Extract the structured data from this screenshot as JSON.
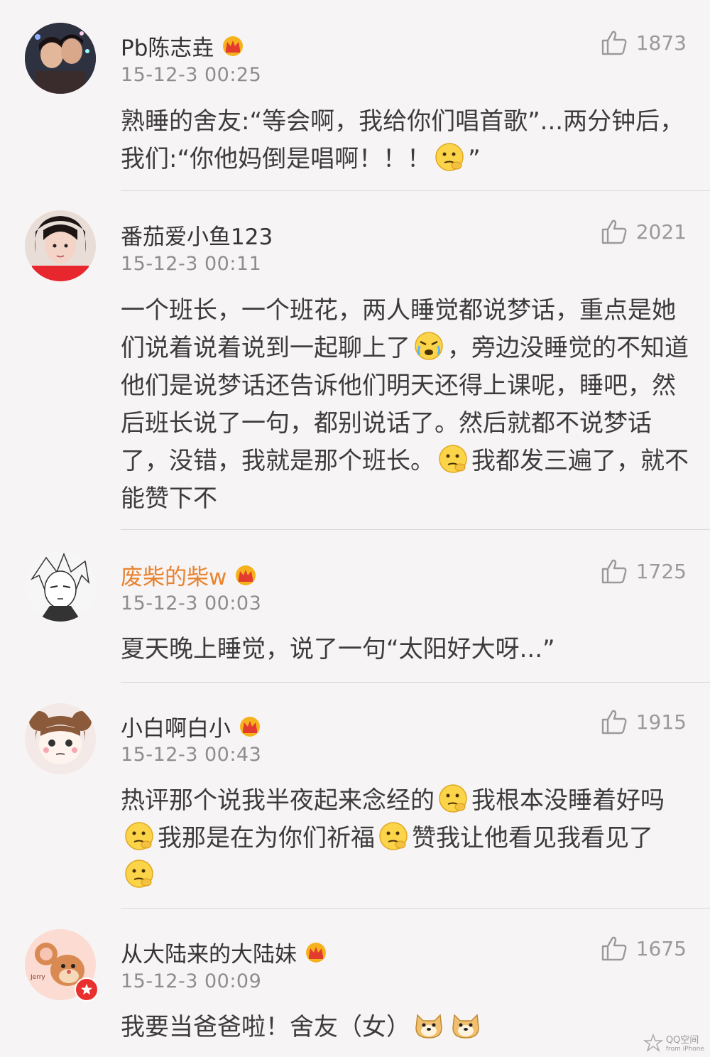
{
  "comments": [
    {
      "name": "Pb陈志垚",
      "time": "15-12-3 00:25",
      "likes": "1873",
      "vip": true,
      "avatar": "avatar-couple",
      "parts": [
        "熟睡的舍友:“等会啊，我给你们唱首歌”...两分钟后，我们:“你他妈倒是唱啊！！！",
        "”"
      ],
      "emojis": [
        "thinking-emoji"
      ]
    },
    {
      "name": "番茄爱小鱼123",
      "time": "15-12-3 00:11",
      "likes": "2021",
      "vip": false,
      "avatar": "avatar-girl",
      "parts": [
        "一个班长，一个班花，两人睡觉都说梦话，重点是她们说着说着说到一起聊上了",
        "，旁边没睡觉的不知道他们是说梦话还告诉他们明天还得上课呢，睡吧，然后班长说了一句，都别说话了。然后就都不说梦话了，没错，我就是那个班长。",
        "我都发三遍了，就不能赞下不"
      ],
      "emojis": [
        "tears-emoji",
        "thinking-emoji"
      ]
    },
    {
      "name": "废柴的柴w",
      "time": "15-12-3 00:03",
      "likes": "1725",
      "vip": true,
      "avatar": "avatar-anime",
      "parts": [
        "夏天晚上睡觉，说了一句“太阳好大呀...”"
      ],
      "emojis": []
    },
    {
      "name": "小白啊白小",
      "time": "15-12-3 00:43",
      "likes": "1915",
      "vip": true,
      "avatar": "avatar-cartoon",
      "parts": [
        "热评那个说我半夜起来念经的",
        "我根本没睡着好吗",
        "我那是在为你们祈福",
        "赞我让他看见我看见了",
        ""
      ],
      "emojis": [
        "thinking-emoji",
        "thinking-emoji",
        "thinking-emoji",
        "thinking-emoji"
      ]
    },
    {
      "name": "从大陆来的大陆妹",
      "time": "15-12-3 00:09",
      "likes": "1675",
      "vip": true,
      "avatar": "avatar-mouse",
      "parts": [
        "我要当爸爸啦！舍友（女）",
        "",
        ""
      ],
      "emojis": [
        "doge-emoji",
        "doge-emoji"
      ]
    }
  ],
  "watermark": {
    "title": "QQ空间",
    "sub": "from iPhone"
  },
  "colors": {
    "background": "#f7f4f5",
    "vip_name": "#e8832f",
    "like_gray": "#9a9a9a"
  }
}
